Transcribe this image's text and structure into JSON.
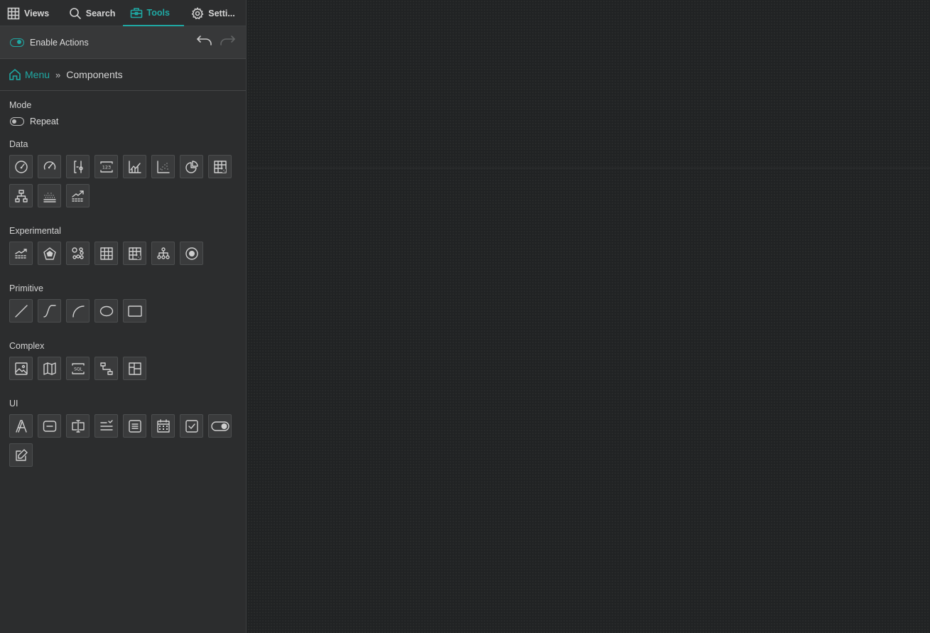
{
  "tabs": {
    "views": "Views",
    "search": "Search",
    "tools": "Tools",
    "settings": "Setti..."
  },
  "actions": {
    "label": "Enable Actions",
    "enabled": true
  },
  "breadcrumb": {
    "menu": "Menu",
    "current": "Components"
  },
  "mode": {
    "title": "Mode",
    "repeat_label": "Repeat",
    "repeat_enabled": false
  },
  "sections": {
    "data": "Data",
    "experimental": "Experimental",
    "primitive": "Primitive",
    "complex": "Complex",
    "ui": "UI"
  },
  "icons": {
    "data": [
      "gauge-icon",
      "radial-gauge-icon",
      "range-icon",
      "number-icon",
      "line-chart-icon",
      "scatter-icon",
      "pie-chart-icon",
      "heatmap-icon",
      "tree-icon",
      "dots-baseline-icon",
      "trend-icon"
    ],
    "experimental": [
      "area-trend-icon",
      "radar-icon",
      "cluster-icon",
      "table-icon",
      "grid-table-icon",
      "graph-icon",
      "target-icon"
    ],
    "primitive": [
      "line-icon",
      "curve-icon",
      "arc-icon",
      "ellipse-icon",
      "rectangle-icon"
    ],
    "complex": [
      "image-icon",
      "map-icon",
      "sql-icon",
      "flow-icon",
      "layout-icon"
    ],
    "ui": [
      "text-icon",
      "button-icon",
      "input-icon",
      "select-icon",
      "list-box-icon",
      "calendar-icon",
      "checkbox-icon",
      "toggle-icon",
      "edit-icon"
    ]
  },
  "colors": {
    "accent": "#1fa8a3",
    "sidebar": "#2c2d2e",
    "canvas": "#212324"
  }
}
